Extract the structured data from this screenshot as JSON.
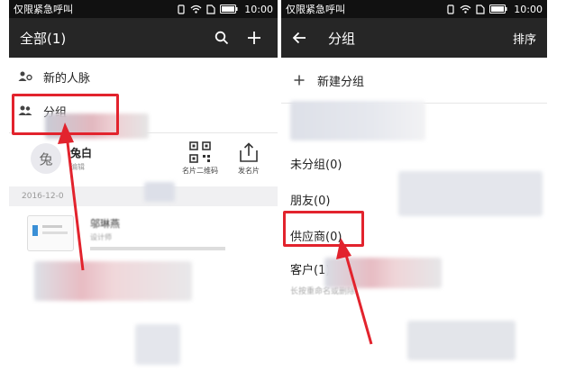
{
  "colors": {
    "accent_red": "#e2232d",
    "appbar": "#262626",
    "statusbar": "#111111"
  },
  "left": {
    "status": {
      "carrier": "仅限紧急呼叫",
      "time": "10:00"
    },
    "appbar": {
      "title": "全部(1)",
      "search_icon": "search-icon",
      "add_icon": "plus-icon"
    },
    "menu": [
      {
        "label": "新的人脉",
        "icon": "new-contacts-icon"
      },
      {
        "label": "分组",
        "icon": "group-icon"
      }
    ],
    "profile": {
      "avatar_char": "兔",
      "name": "兔白",
      "sub": "编辑"
    },
    "actions": [
      {
        "label": "名片二维码",
        "icon": "qr-code-icon"
      },
      {
        "label": "发名片",
        "icon": "share-icon"
      }
    ],
    "date_header": "2016-12-0",
    "contact": {
      "name": "邬琳燕",
      "sub": "设计师"
    }
  },
  "right": {
    "status": {
      "carrier": "仅限紧急呼叫",
      "time": "10:00"
    },
    "appbar": {
      "title": "分组",
      "sort_label": "排序"
    },
    "new_group": "新建分组",
    "groups": [
      {
        "label": "未分组(0)"
      },
      {
        "label": "朋友(0)"
      },
      {
        "label": "供应商(0)"
      },
      {
        "label": "客户(1)"
      }
    ],
    "footer_hint": "长按重命名或删除"
  }
}
